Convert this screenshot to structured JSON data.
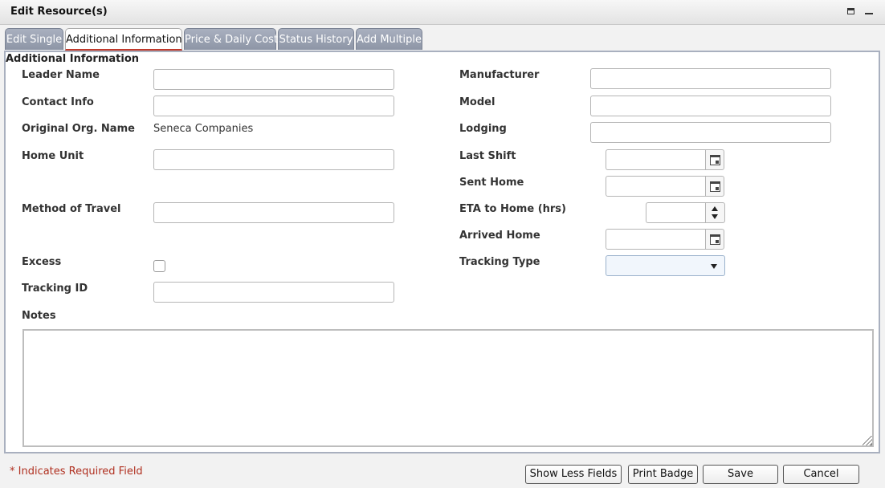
{
  "window": {
    "title": "Edit Resource(s)"
  },
  "tabs": [
    {
      "label": "Edit Single",
      "active": false
    },
    {
      "label": "Additional Information",
      "active": true
    },
    {
      "label": "Price & Daily Cost",
      "active": false
    },
    {
      "label": "Status History",
      "active": false
    },
    {
      "label": "Add Multiple",
      "active": false
    }
  ],
  "section": {
    "title": "Additional Information"
  },
  "left_fields": {
    "leader_name": {
      "label": "Leader Name",
      "value": ""
    },
    "contact_info": {
      "label": "Contact Info",
      "value": ""
    },
    "original_org_name": {
      "label": "Original Org. Name",
      "value": "Seneca Companies"
    },
    "home_unit": {
      "label": "Home Unit",
      "value": ""
    },
    "method_of_travel": {
      "label": "Method of Travel",
      "value": ""
    },
    "excess": {
      "label": "Excess",
      "checked": false
    },
    "tracking_id": {
      "label": "Tracking ID",
      "value": ""
    },
    "notes": {
      "label": "Notes",
      "value": ""
    }
  },
  "right_fields": {
    "manufacturer": {
      "label": "Manufacturer",
      "value": ""
    },
    "model": {
      "label": "Model",
      "value": ""
    },
    "lodging": {
      "label": "Lodging",
      "value": ""
    },
    "last_shift": {
      "label": "Last Shift",
      "value": ""
    },
    "sent_home": {
      "label": "Sent Home",
      "value": ""
    },
    "eta_to_home": {
      "label": "ETA to Home (hrs)",
      "value": ""
    },
    "arrived_home": {
      "label": "Arrived Home",
      "value": ""
    },
    "tracking_type": {
      "label": "Tracking Type",
      "value": ""
    }
  },
  "footer": {
    "required_note": "* Indicates Required Field",
    "buttons": {
      "show_less": "Show Less Fields",
      "print_badge": "Print Badge",
      "save": "Save",
      "cancel": "Cancel"
    }
  },
  "colors": {
    "tab_inactive": "#9aa1b1",
    "required_text": "#b03020",
    "panel_border": "#a9b0bf"
  }
}
